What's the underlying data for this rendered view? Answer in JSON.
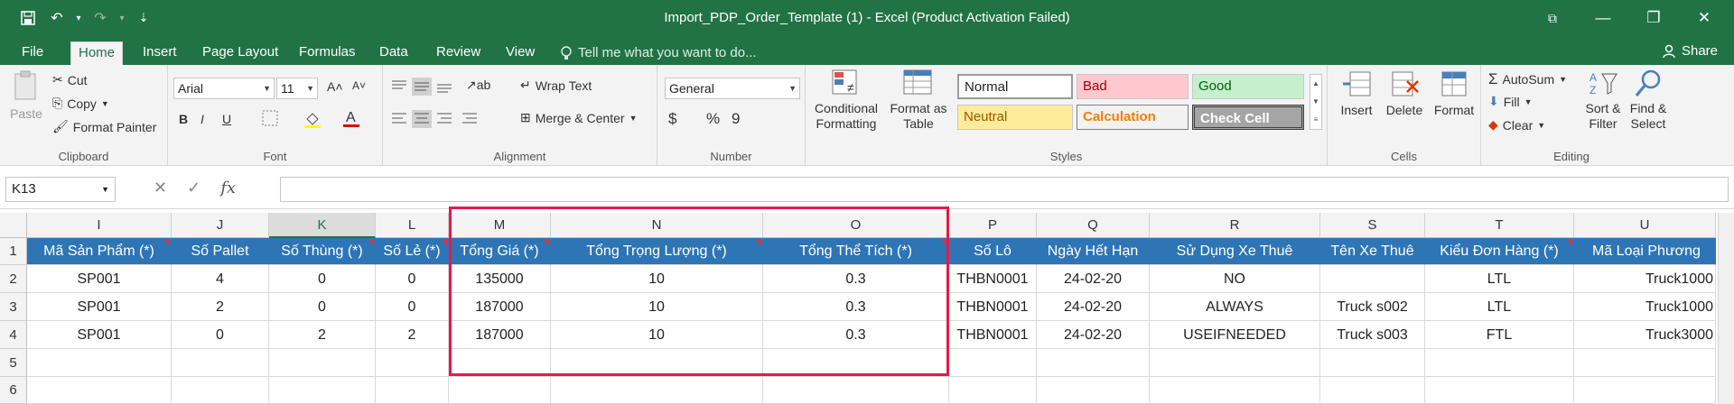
{
  "window": {
    "title": "Import_PDP_Order_Template (1) - Excel (Product Activation Failed)",
    "controls": {
      "restore_ribbon": "⧉",
      "minimize": "—",
      "maximize": "❐",
      "close": "✕"
    }
  },
  "qat": {
    "save": "💾",
    "undo": "↶",
    "undo_dd": "▾",
    "redo": "↷",
    "redo_dd": "▾",
    "customize": "⇣"
  },
  "tabs": [
    "File",
    "Home",
    "Insert",
    "Page Layout",
    "Formulas",
    "Data",
    "Review",
    "View"
  ],
  "tell_me": "Tell me what you want to do...",
  "share": "Share",
  "ribbon": {
    "clipboard": {
      "label": "Clipboard",
      "paste": "Paste",
      "cut": "Cut",
      "copy": "Copy",
      "format_painter": "Format Painter"
    },
    "font": {
      "label": "Font",
      "name": "Arial",
      "size": "11",
      "grow": "A˄",
      "shrink": "A˅",
      "bold": "B",
      "italic": "I",
      "underline": "U"
    },
    "alignment": {
      "label": "Alignment",
      "wrap": "Wrap Text",
      "merge": "Merge & Center"
    },
    "number": {
      "label": "Number",
      "format": "General",
      "currency": "$",
      "percent": "%",
      "comma": "9"
    },
    "styles": {
      "label": "Styles",
      "conditional": [
        "Conditional",
        "Formatting"
      ],
      "format_table": [
        "Format as",
        "Table"
      ],
      "normal": "Normal",
      "bad": "Bad",
      "good": "Good",
      "neutral": "Neutral",
      "calculation": "Calculation",
      "check_cell": "Check Cell"
    },
    "cells": {
      "label": "Cells",
      "insert": "Insert",
      "delete": "Delete",
      "format": "Format"
    },
    "editing": {
      "label": "Editing",
      "autosum": "AutoSum",
      "fill": "Fill",
      "clear": "Clear",
      "sort": [
        "Sort &",
        "Filter"
      ],
      "find": [
        "Find &",
        "Select"
      ]
    }
  },
  "formula_bar": {
    "name_box": "K13",
    "fx": "fx",
    "cancel": "✕",
    "enter": "✓",
    "value": ""
  },
  "columns": [
    "I",
    "J",
    "K",
    "L",
    "M",
    "N",
    "O",
    "P",
    "Q",
    "R",
    "S",
    "T",
    "U"
  ],
  "selected_column": "K",
  "rows": [
    "1",
    "2",
    "3",
    "4",
    "5",
    "6"
  ],
  "headers": [
    "Mã Sản Phẩm (*)",
    "Số Pallet",
    "Số Thùng (*)",
    "Số Lẻ (*)",
    "Tổng Giá (*)",
    "Tổng Trọng Lượng (*)",
    "Tổng Thể Tích (*)",
    "Số Lô",
    "Ngày Hết Hạn",
    "Sử Dụng Xe Thuê",
    "Tên Xe Thuê",
    "Kiểu Đơn Hàng (*)",
    "Mã Loại Phương"
  ],
  "data_rows": [
    [
      "SP001",
      "4",
      "0",
      "0",
      "135000",
      "10",
      "0.3",
      "THBN0001",
      "24-02-20",
      "NO",
      "",
      "LTL",
      "Truck1000"
    ],
    [
      "SP001",
      "2",
      "0",
      "0",
      "187000",
      "10",
      "0.3",
      "THBN0001",
      "24-02-20",
      "ALWAYS",
      "Truck s002",
      "LTL",
      "Truck1000"
    ],
    [
      "SP001",
      "0",
      "2",
      "2",
      "187000",
      "10",
      "0.3",
      "THBN0001",
      "24-02-20",
      "USEIFNEEDED",
      "Truck s003",
      "FTL",
      "Truck3000"
    ]
  ],
  "colors": {
    "excel_green": "#217346",
    "header_blue": "#2e75b6",
    "highlight_red": "#e6194b"
  }
}
